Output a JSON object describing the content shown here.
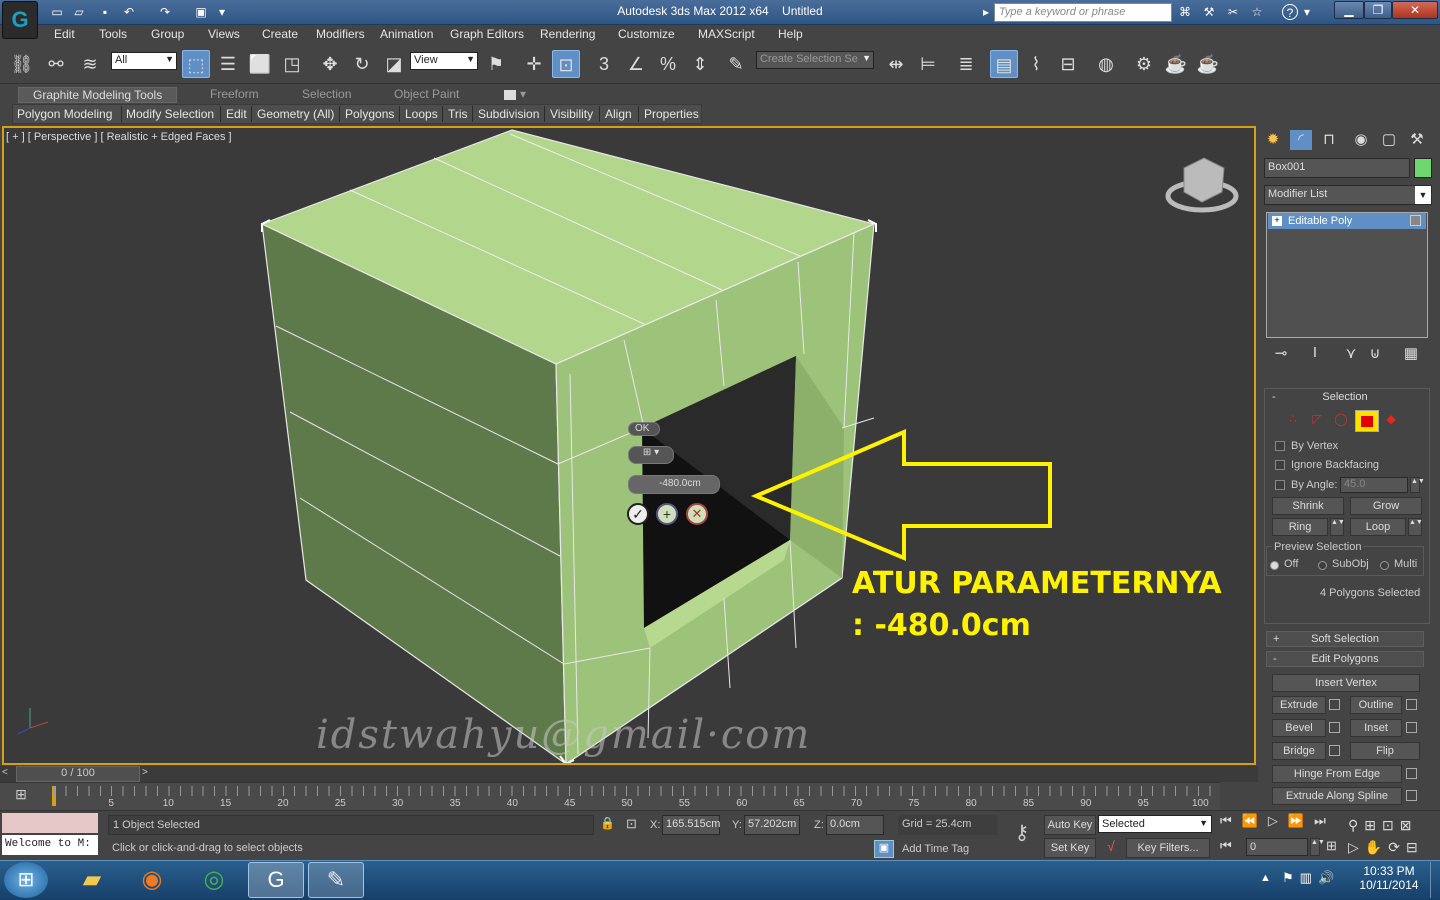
{
  "window": {
    "title": "Autodesk 3ds Max  2012 x64",
    "file": "Untitled"
  },
  "search": {
    "placeholder": "Type a keyword or phrase"
  },
  "menu": [
    "Edit",
    "Tools",
    "Group",
    "Views",
    "Create",
    "Modifiers",
    "Animation",
    "Graph Editors",
    "Rendering",
    "Customize",
    "MAXScript",
    "Help"
  ],
  "toolbar": {
    "filter_value": "All",
    "refcoord_value": "View",
    "snap_labels": [
      "3",
      "%"
    ],
    "named_selection_placeholder": "Create Selection Se"
  },
  "ribbon": {
    "tabs": [
      "Graphite Modeling Tools",
      "Freeform",
      "Selection",
      "Object Paint"
    ],
    "panels": [
      "Polygon Modeling",
      "Modify Selection",
      "Edit",
      "Geometry (All)",
      "Polygons",
      "Loops",
      "Tris",
      "Subdivision",
      "Visibility",
      "Align",
      "Properties"
    ]
  },
  "viewport": {
    "label": "[ + ] [ Perspective ] [ Realistic + Edged Faces ]",
    "caddy_ok": "OK",
    "caddy_value": "-480.0cm"
  },
  "annotation": {
    "line1": "ATUR PARAMETERNYA",
    "line2": ": -480.0cm"
  },
  "watermark": "idstwahyu@gmail·com",
  "command_panel": {
    "object_name": "Box001",
    "object_color": "#6ed86e",
    "modifier_list": "Modifier List",
    "stack_item": "Editable Poly",
    "selection_header": "Selection",
    "by_vertex": "By Vertex",
    "ignore_backfacing": "Ignore Backfacing",
    "by_angle": "By Angle:",
    "angle_value": "45.0",
    "shrink": "Shrink",
    "grow": "Grow",
    "ring": "Ring",
    "loop": "Loop",
    "preview_selection": "Preview Selection",
    "preview_off": "Off",
    "preview_subobj": "SubObj",
    "preview_multi": "Multi",
    "polygons_selected": "4 Polygons Selected",
    "soft_selection": "Soft Selection",
    "edit_polygons": "Edit Polygons",
    "insert_vertex": "Insert Vertex",
    "extrude": "Extrude",
    "outline": "Outline",
    "bevel": "Bevel",
    "inset": "Inset",
    "bridge": "Bridge",
    "flip": "Flip",
    "hinge_from_edge": "Hinge From Edge",
    "extrude_along_spline": "Extrude Along Spline"
  },
  "timeline": {
    "frame_counter": "0 / 100",
    "ticks": [
      "5",
      "10",
      "15",
      "20",
      "25",
      "30",
      "35",
      "40",
      "45",
      "50",
      "55",
      "60",
      "65",
      "70",
      "75",
      "80",
      "85",
      "90",
      "95",
      "100"
    ]
  },
  "status": {
    "maxscript": "Welcome to M:",
    "selected": "1 Object Selected",
    "prompt": "Click or click-and-drag to select objects",
    "x_label": "X:",
    "x_value": "165.515cm",
    "y_label": "Y:",
    "y_value": "57.202cm",
    "z_label": "Z:",
    "z_value": "0.0cm",
    "grid": "Grid = 25.4cm",
    "add_time_tag": "Add Time Tag",
    "auto_key": "Auto Key",
    "set_key": "Set Key",
    "key_mode": "Selected",
    "key_filters": "Key Filters...",
    "frame_value": "0"
  },
  "taskbar": {
    "time": "10:33 PM",
    "date": "10/11/2014"
  }
}
